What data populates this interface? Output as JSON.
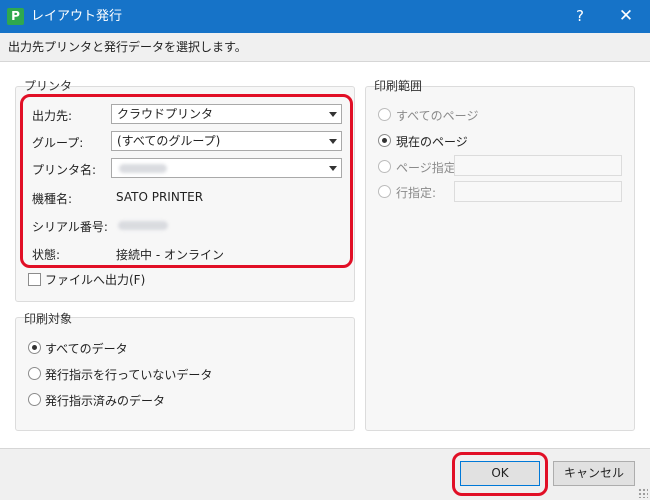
{
  "window": {
    "title": "レイアウト発行",
    "help_glyph": "?",
    "close_glyph": "✕"
  },
  "instruction": "出力先プリンタと発行データを選択します。",
  "printer_group": {
    "label": "プリンタ",
    "output_label": "出力先:",
    "output_value": "クラウドプリンタ",
    "group_label": "グループ:",
    "group_value": "(すべてのグループ)",
    "printer_name_label": "プリンタ名:",
    "model_label": "機種名:",
    "model_value": "SATO PRINTER",
    "serial_label": "シリアル番号:",
    "status_label": "状態:",
    "status_value": "接続中 - オンライン"
  },
  "file_output": {
    "label": "ファイルへ出力(F)",
    "checked": false
  },
  "target_group": {
    "label": "印刷対象",
    "options": [
      "すべてのデータ",
      "発行指示を行っていないデータ",
      "発行指示済みのデータ"
    ],
    "selected": 0
  },
  "range_group": {
    "label": "印刷範囲",
    "all_pages": "すべてのページ",
    "current_page": "現在のページ",
    "page_spec": "ページ指定:",
    "line_spec": "行指定:",
    "selected": "current_page"
  },
  "footer": {
    "ok_label": "OK",
    "cancel_label": "キャンセル"
  },
  "colors": {
    "titlebar": "#1673c8",
    "highlight": "#e10f26",
    "app_icon": "#2fa84f"
  },
  "icons": {
    "app": "app-logo-icon",
    "combo": "chevron-down-icon"
  }
}
